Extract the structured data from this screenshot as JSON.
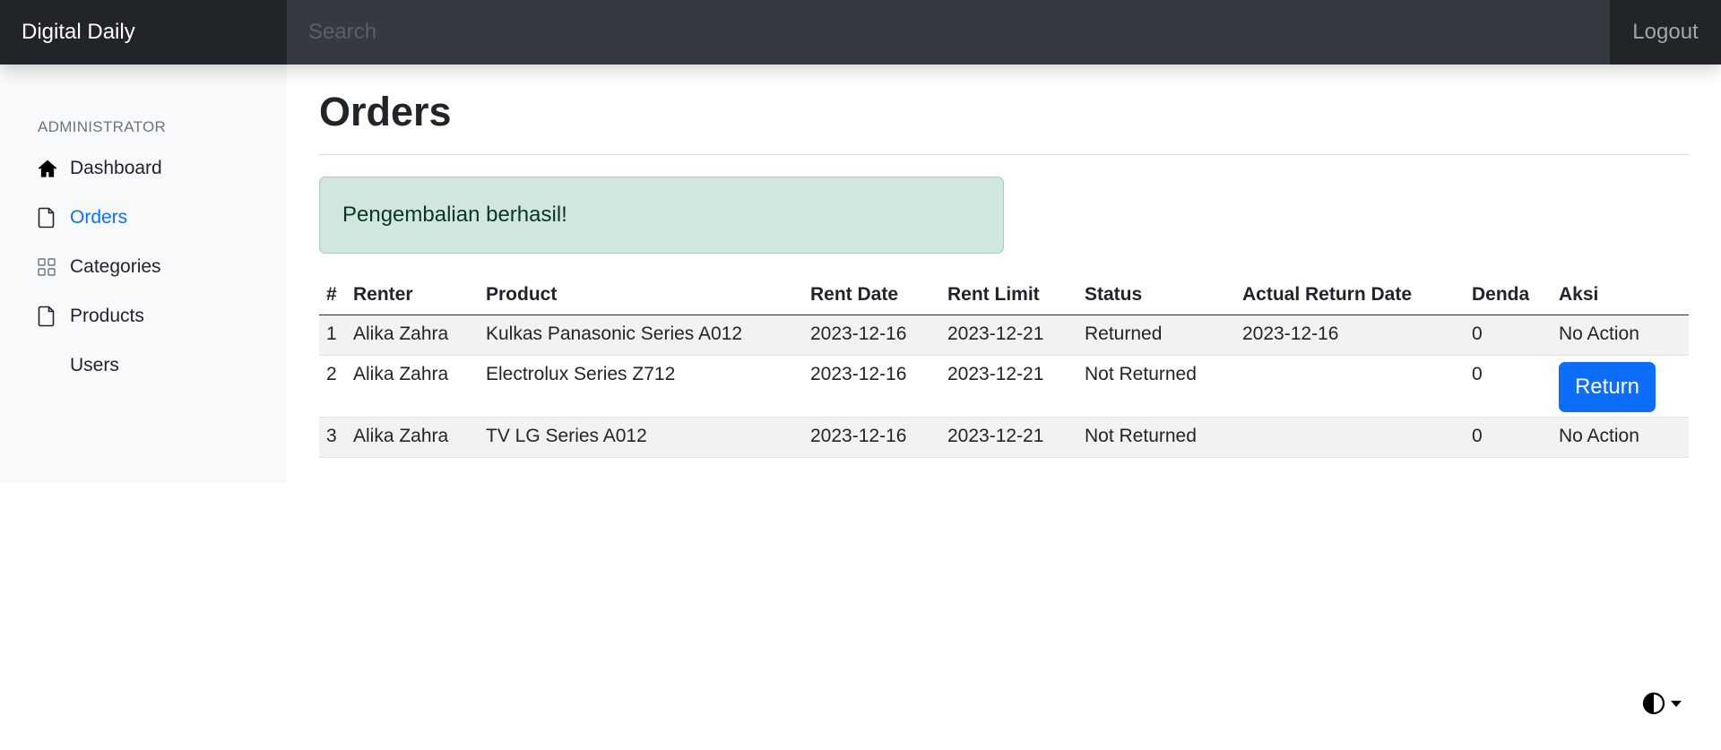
{
  "navbar": {
    "brand": "Digital Daily",
    "search_placeholder": "Search",
    "logout": "Logout"
  },
  "sidebar": {
    "heading": "ADMINISTRATOR",
    "items": [
      {
        "label": "Dashboard",
        "icon": "house-icon",
        "active": false
      },
      {
        "label": "Orders",
        "icon": "file-icon",
        "active": true
      },
      {
        "label": "Categories",
        "icon": "grid-icon",
        "active": false
      },
      {
        "label": "Products",
        "icon": "file-icon",
        "active": false
      },
      {
        "label": "Users",
        "icon": "",
        "active": false
      }
    ]
  },
  "main": {
    "title": "Orders",
    "alert": "Pengembalian berhasil!",
    "table": {
      "headers": [
        "#",
        "Renter",
        "Product",
        "Rent Date",
        "Rent Limit",
        "Status",
        "Actual Return Date",
        "Denda",
        "Aksi"
      ],
      "rows": [
        {
          "no": "1",
          "renter": "Alika Zahra",
          "product": "Kulkas Panasonic Series A012",
          "rent_date": "2023-12-16",
          "rent_limit": "2023-12-21",
          "status": "Returned",
          "actual_return": "2023-12-16",
          "denda": "0",
          "aksi": "No Action"
        },
        {
          "no": "2",
          "renter": "Alika Zahra",
          "product": "Electrolux Series Z712",
          "rent_date": "2023-12-16",
          "rent_limit": "2023-12-21",
          "status": "Not Returned",
          "actual_return": "",
          "denda": "0",
          "aksi": "Return"
        },
        {
          "no": "3",
          "renter": "Alika Zahra",
          "product": "TV LG Series A012",
          "rent_date": "2023-12-16",
          "rent_limit": "2023-12-21",
          "status": "Not Returned",
          "actual_return": "",
          "denda": "0",
          "aksi": "No Action"
        }
      ]
    }
  },
  "colors": {
    "accent": "#0d6efd",
    "navbar": "#343a40",
    "brand_bg": "#212529",
    "alert_bg": "#d1e7dd"
  },
  "theme_toggle": {
    "icon": "contrast-icon"
  }
}
